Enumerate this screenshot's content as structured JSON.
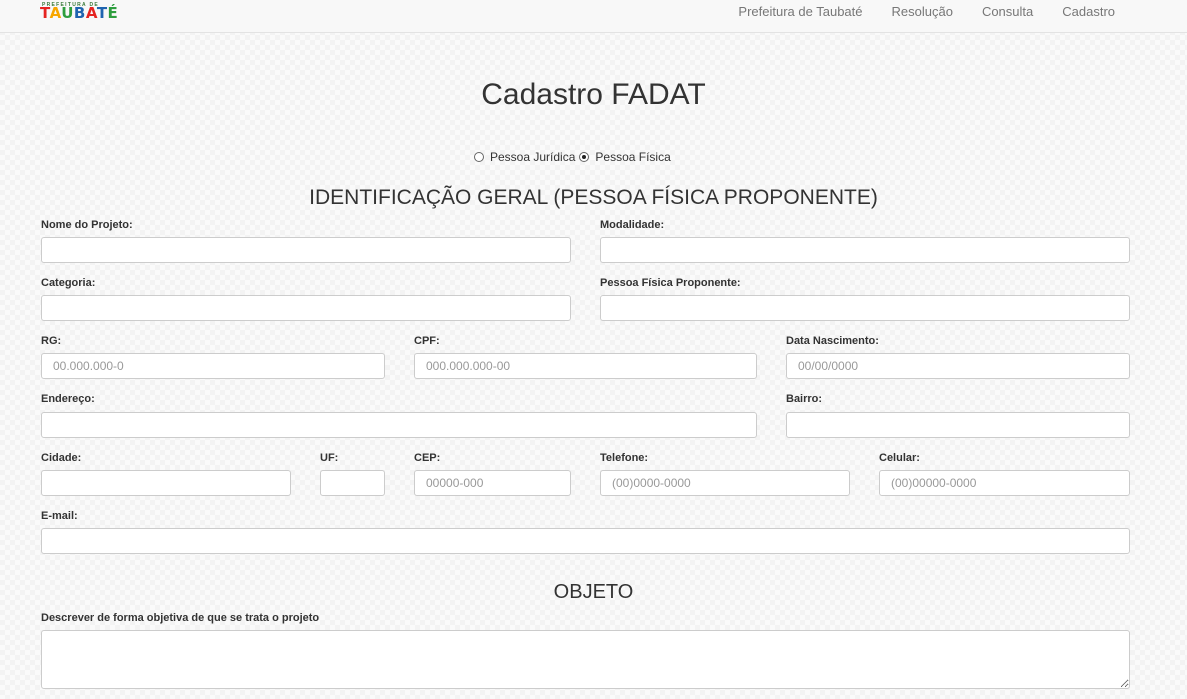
{
  "navbar": {
    "logo_top": "PREFEITURA DE",
    "logo_word": [
      "T",
      "A",
      "U",
      "B",
      "A",
      "T",
      "É"
    ],
    "links": [
      "Prefeitura de Taubaté",
      "Resolução",
      "Consulta",
      "Cadastro"
    ]
  },
  "page": {
    "title": "Cadastro FADAT"
  },
  "person_type": {
    "options": [
      "Pessoa Jurídica",
      "Pessoa Física"
    ],
    "selected": "Pessoa Física"
  },
  "identificacao": {
    "title": "IDENTIFICAÇÃO GERAL (PESSOA FÍSICA PROPONENTE)",
    "fields": {
      "nome_projeto": {
        "label": "Nome do Projeto:",
        "value": "",
        "placeholder": ""
      },
      "modalidade": {
        "label": "Modalidade:",
        "value": "",
        "placeholder": ""
      },
      "categoria": {
        "label": "Categoria:",
        "value": "",
        "placeholder": ""
      },
      "proponente": {
        "label": "Pessoa Física Proponente:",
        "value": "",
        "placeholder": ""
      },
      "rg": {
        "label": "RG:",
        "value": "",
        "placeholder": "00.000.000-0"
      },
      "cpf": {
        "label": "CPF:",
        "value": "",
        "placeholder": "000.000.000-00"
      },
      "nascimento": {
        "label": "Data Nascimento:",
        "value": "",
        "placeholder": "00/00/0000"
      },
      "endereco": {
        "label": "Endereço:",
        "value": "",
        "placeholder": ""
      },
      "bairro": {
        "label": "Bairro:",
        "value": "",
        "placeholder": ""
      },
      "cidade": {
        "label": "Cidade:",
        "value": "",
        "placeholder": ""
      },
      "uf": {
        "label": "UF:",
        "value": "",
        "placeholder": ""
      },
      "cep": {
        "label": "CEP:",
        "value": "",
        "placeholder": "00000-000"
      },
      "telefone": {
        "label": "Telefone:",
        "value": "",
        "placeholder": "(00)0000-0000"
      },
      "celular": {
        "label": "Celular:",
        "value": "",
        "placeholder": "(00)00000-0000"
      },
      "email": {
        "label": "E-mail:",
        "value": "",
        "placeholder": ""
      }
    }
  },
  "objeto": {
    "title": "OBJETO",
    "descricao": {
      "label": "Descrever de forma objetiva de que se trata o projeto",
      "value": "",
      "placeholder": ""
    }
  }
}
